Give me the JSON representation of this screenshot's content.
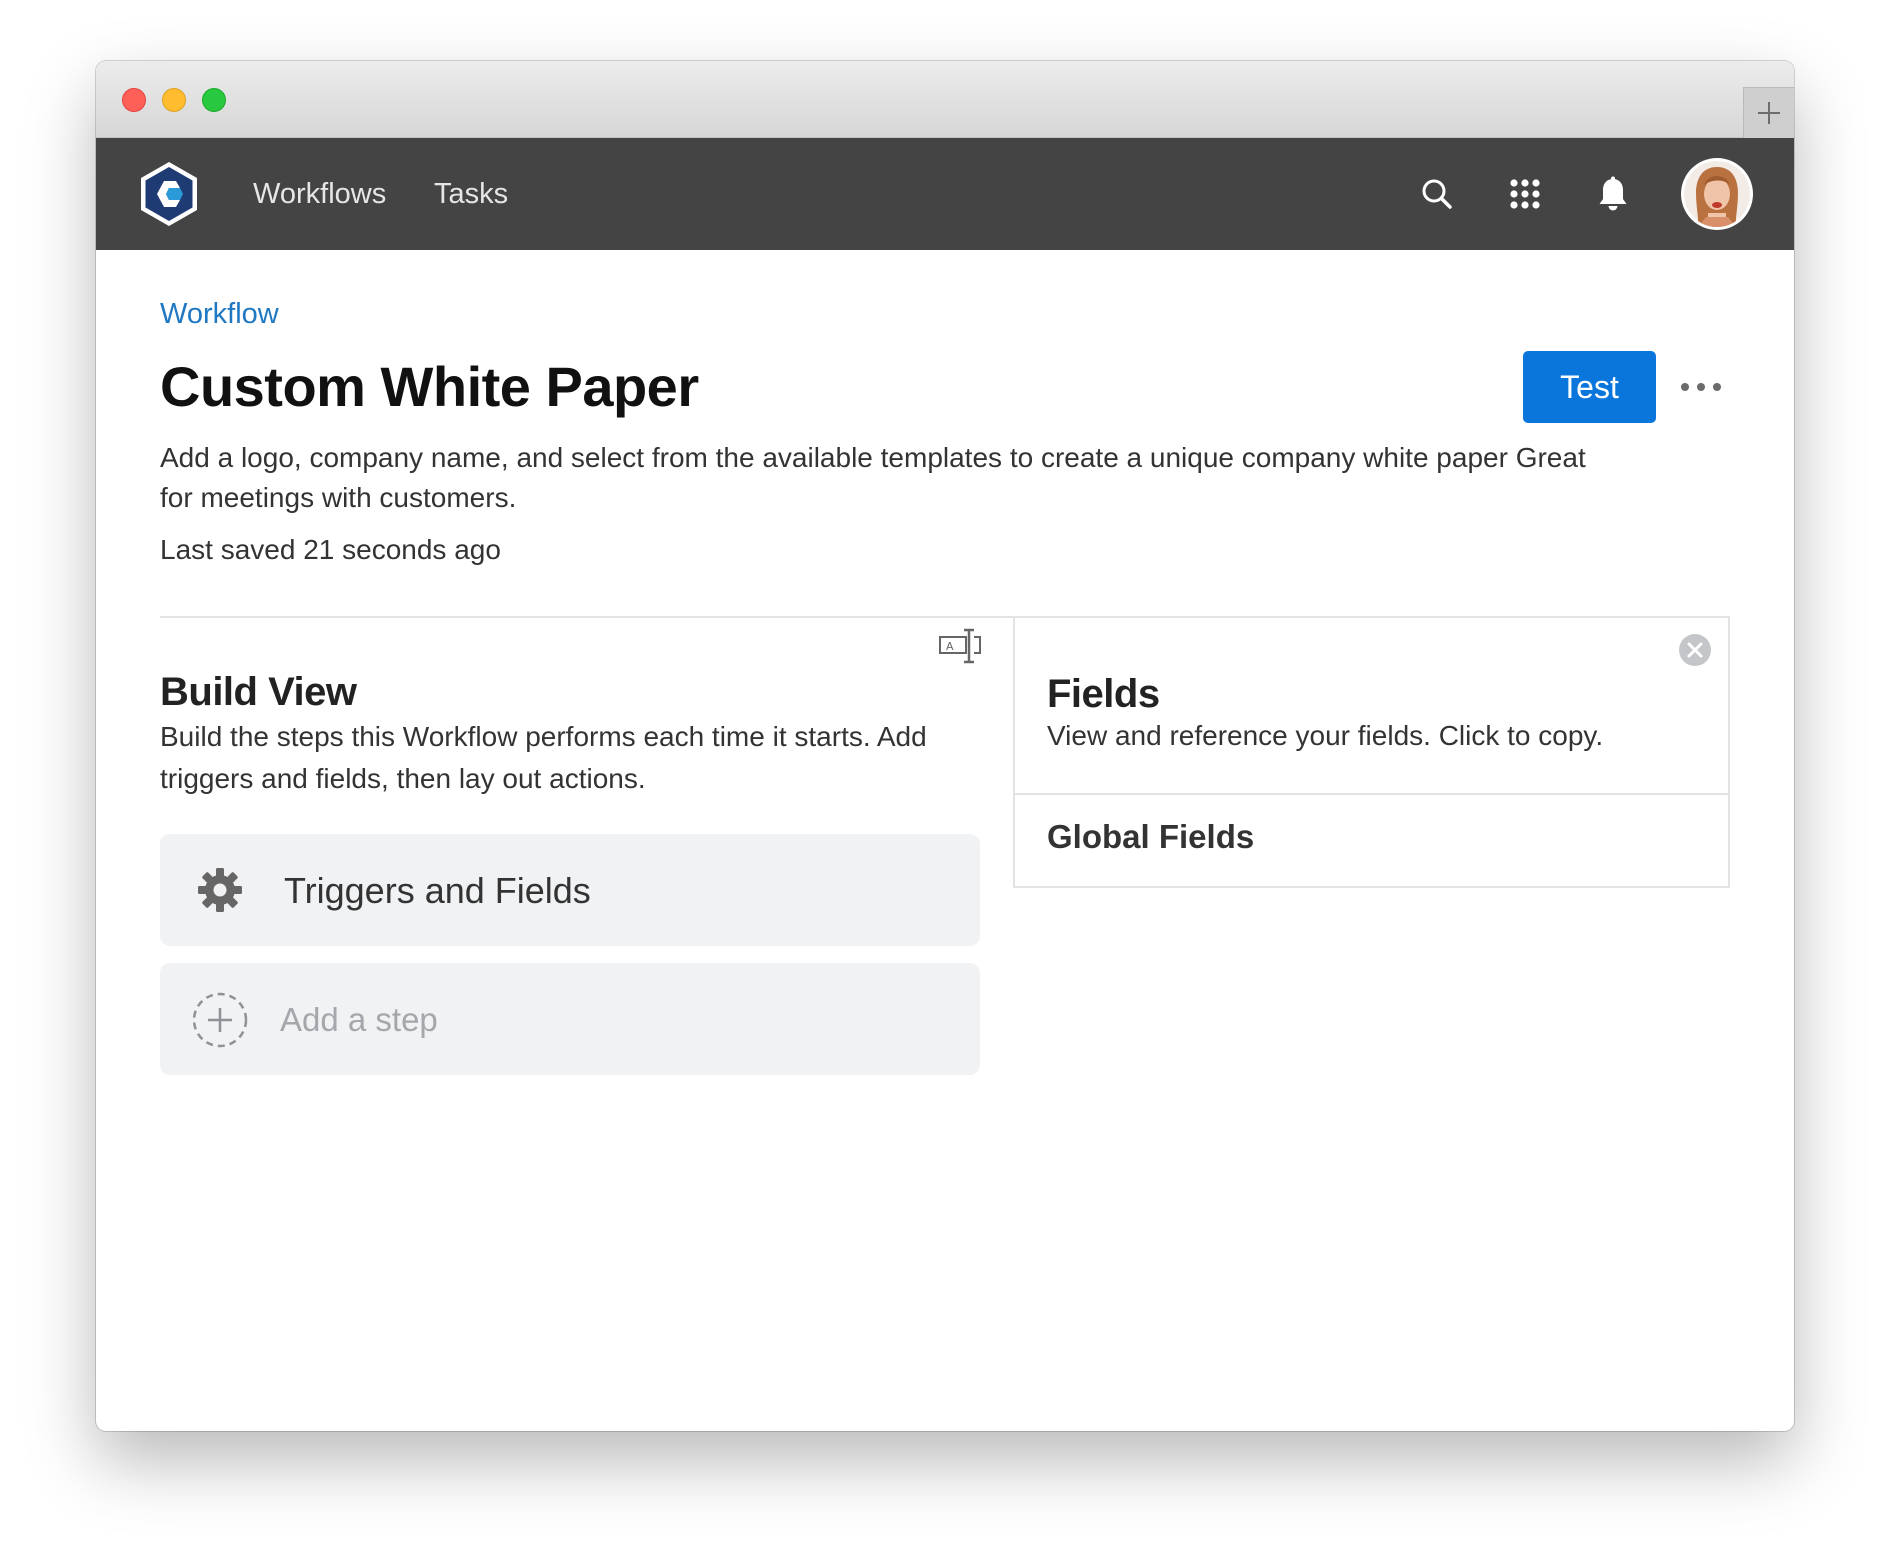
{
  "navbar": {
    "links": [
      {
        "label": "Workflows"
      },
      {
        "label": "Tasks"
      }
    ],
    "icons": [
      "search-icon",
      "apps-grid-icon",
      "bell-icon"
    ],
    "background": "#444444"
  },
  "page": {
    "breadcrumb": "Workflow",
    "title": "Custom White Paper",
    "test_label": "Test",
    "description": "Add a logo, company name, and select from the available templates to create a unique company white paper Great for meetings with customers.",
    "last_saved": "Last saved 21 seconds ago",
    "accent": "#0a76db",
    "link_color": "#1f78c1"
  },
  "build_view": {
    "title": "Build View",
    "description": "Build the steps this Workflow performs each time it starts. Add triggers and fields, then lay out actions.",
    "steps": [
      {
        "label": "Triggers and Fields",
        "icon": "gear-icon"
      },
      {
        "label": "Add a step",
        "icon": "add-circle-icon"
      }
    ]
  },
  "fields_panel": {
    "title": "Fields",
    "description": "View and reference your fields. Click to copy.",
    "section": "Global Fields"
  }
}
